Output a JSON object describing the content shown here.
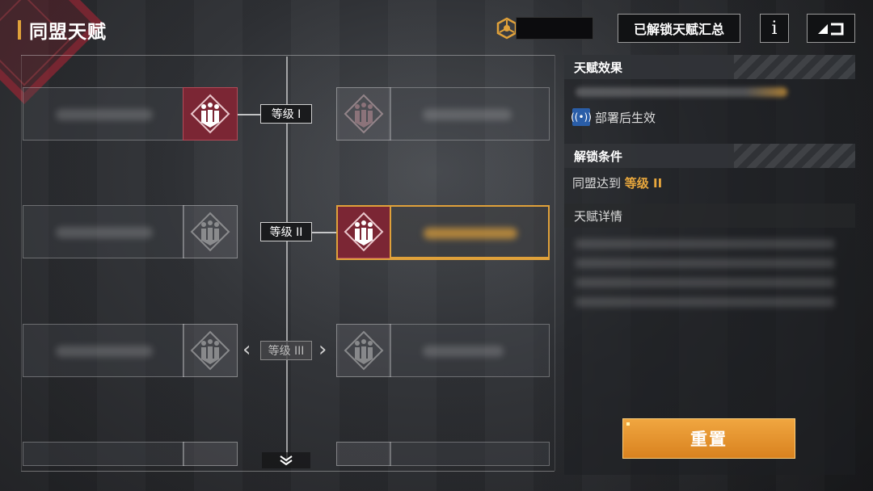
{
  "header": {
    "title": "同盟天赋",
    "summary_button": "已解锁天赋汇总",
    "info_button": "i"
  },
  "tree": {
    "tiers": [
      {
        "label": "等级 I",
        "state": "unlocked"
      },
      {
        "label": "等级 II",
        "state": "selected"
      },
      {
        "label": "等级 III",
        "state": "locked"
      }
    ]
  },
  "panel": {
    "effect_title": "天赋效果",
    "deploy_text": "部署后生效",
    "unlock_title": "解锁条件",
    "unlock_prefix": "同盟达到 ",
    "unlock_level": "等级 II",
    "detail_title": "天赋详情"
  },
  "actions": {
    "reset_label": "重置"
  },
  "colors": {
    "accent": "#e0a13a",
    "node_active": "#7b2634",
    "reset": "#e39430"
  }
}
